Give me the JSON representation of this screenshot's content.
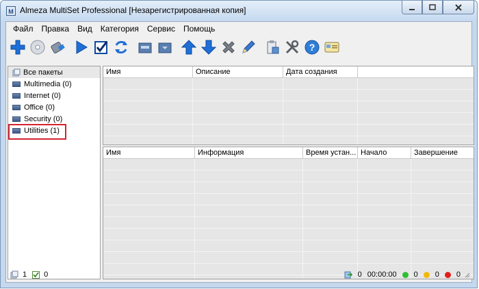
{
  "window": {
    "title": "Almeza MultiSet Professional [Незарегистрированная копия]",
    "app_icon_letter": "M"
  },
  "menu": [
    "Файл",
    "Правка",
    "Вид",
    "Категория",
    "Сервис",
    "Помощь"
  ],
  "toolbar": [
    "add-icon",
    "disc-icon",
    "usb-drive-icon",
    "play-icon",
    "checkbox-icon",
    "refresh-icon",
    "folder-out-icon",
    "folder-in-icon",
    "move-up-icon",
    "move-down-icon",
    "delete-icon",
    "edit-pencil-icon",
    "clipboard-icon",
    "tools-icon",
    "help-icon",
    "card-icon"
  ],
  "tree": {
    "items": [
      {
        "label": "Все пакеты",
        "selected": true
      },
      {
        "label": "Multimedia (0)"
      },
      {
        "label": "Internet (0)"
      },
      {
        "label": "Office (0)"
      },
      {
        "label": "Security (0)"
      },
      {
        "label": "Utilities (1)",
        "highlighted": true
      }
    ]
  },
  "packages_table": {
    "columns": [
      "Имя",
      "Описание",
      "Дата создания"
    ]
  },
  "details_table": {
    "columns": [
      "Имя",
      "Информация",
      "Время устан...",
      "Начало",
      "Завершение"
    ]
  },
  "status": {
    "packages_count": "1",
    "checked_count": "0",
    "elapsed": "0",
    "time": "00:00:00",
    "green_count": "0",
    "yellow_count": "0",
    "red_count": "0"
  },
  "colors": {
    "highlight_border": "#d4232e",
    "green": "#2fbf2f",
    "yellow": "#f2b90c",
    "red": "#e0201c"
  }
}
